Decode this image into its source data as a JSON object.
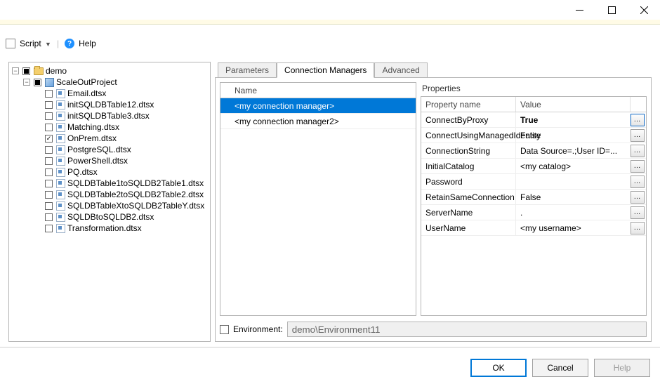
{
  "toolbar": {
    "script_label": "Script",
    "help_label": "Help"
  },
  "tree": {
    "root": "demo",
    "project": "ScaleOutProject",
    "packages": [
      "Email.dtsx",
      "initSQLDBTable12.dtsx",
      "initSQLDBTable3.dtsx",
      "Matching.dtsx",
      "OnPrem.dtsx",
      "PostgreSQL.dtsx",
      "PowerShell.dtsx",
      "PQ.dtsx",
      "SQLDBTable1toSQLDB2Table1.dtsx",
      "SQLDBTable2toSQLDB2Table2.dtsx",
      "SQLDBTableXtoSQLDB2TableY.dtsx",
      "SQLDBtoSQLDB2.dtsx",
      "Transformation.dtsx"
    ],
    "checked": [
      "OnPrem.dtsx"
    ]
  },
  "tabs": {
    "parameters": "Parameters",
    "connection_managers": "Connection Managers",
    "advanced": "Advanced"
  },
  "cm_list": {
    "header": "Name",
    "items": [
      "<my connection manager>",
      "<my connection manager2>"
    ],
    "selected_index": 0
  },
  "properties": {
    "title": "Properties",
    "columns": {
      "name": "Property name",
      "value": "Value"
    },
    "rows": [
      {
        "name": "ConnectByProxy",
        "value": "True",
        "bold": true,
        "active": true
      },
      {
        "name": "ConnectUsingManagedIdentity",
        "value": "False"
      },
      {
        "name": "ConnectionString",
        "value": "Data Source=.;User ID=..."
      },
      {
        "name": "InitialCatalog",
        "value": "<my catalog>"
      },
      {
        "name": "Password",
        "value": ""
      },
      {
        "name": "RetainSameConnection",
        "value": "False"
      },
      {
        "name": "ServerName",
        "value": "."
      },
      {
        "name": "UserName",
        "value": "<my username>"
      }
    ]
  },
  "environment": {
    "label": "Environment:",
    "value": "demo\\Environment11"
  },
  "buttons": {
    "ok": "OK",
    "cancel": "Cancel",
    "help": "Help"
  }
}
